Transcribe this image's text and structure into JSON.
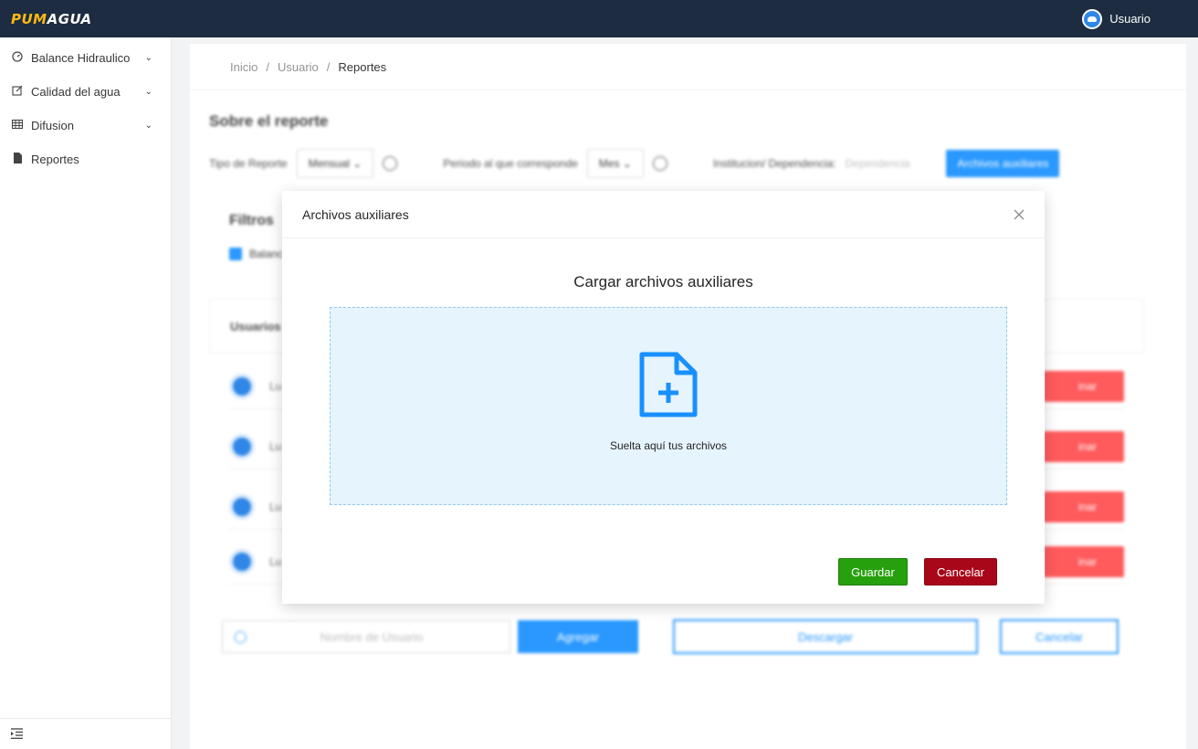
{
  "app": {
    "logo_part1": "PUM",
    "logo_part2": "AGUA",
    "user_label": "Usuario"
  },
  "sidebar": {
    "items": [
      {
        "label": "Balance Hidraulico",
        "icon": "dashboard-icon",
        "has_submenu": true
      },
      {
        "label": "Calidad del agua",
        "icon": "edit-icon",
        "has_submenu": true
      },
      {
        "label": "Difusion",
        "icon": "table-icon",
        "has_submenu": true
      },
      {
        "label": "Reportes",
        "icon": "file-icon",
        "has_submenu": false
      }
    ],
    "collapse_icon": "menu-fold-icon"
  },
  "breadcrumb": {
    "items": [
      "Inicio",
      "Usuario",
      "Reportes"
    ],
    "separator": "/"
  },
  "report": {
    "title": "Sobre el reporte",
    "tipo_label": "Tipo de Reporte",
    "tipo_value": "Mensual",
    "periodo_label": "Periodo al que corresponde",
    "periodo_value": "Mes",
    "institucion_label": "Institucion/ Dependencia:",
    "institucion_placeholder": "Dependencia",
    "aux_button": "Archivos auxiliares",
    "filters_title": "Filtros",
    "filter_checkbox_partial": "Balanc",
    "users_header_partial": "Usuarios",
    "user_rows_partial": [
      "Lu",
      "Lu",
      "Lu",
      "Lu"
    ],
    "delete_label_partial": "inar",
    "user_input_placeholder": "Nombre de Usuario",
    "add_button": "Agregar",
    "download_button": "Descargar",
    "cancel_button": "Cancelar"
  },
  "modal": {
    "title": "Archivos auxiliares",
    "upload_heading": "Cargar archivos auxiliares",
    "drop_text": "Suelta aquí tus archivos",
    "save_button": "Guardar",
    "cancel_button": "Cancelar",
    "colors": {
      "save": "#27a00e",
      "cancel": "#a8071a",
      "dropzone_bg": "#e6f4fd",
      "accent": "#1890ff"
    }
  }
}
